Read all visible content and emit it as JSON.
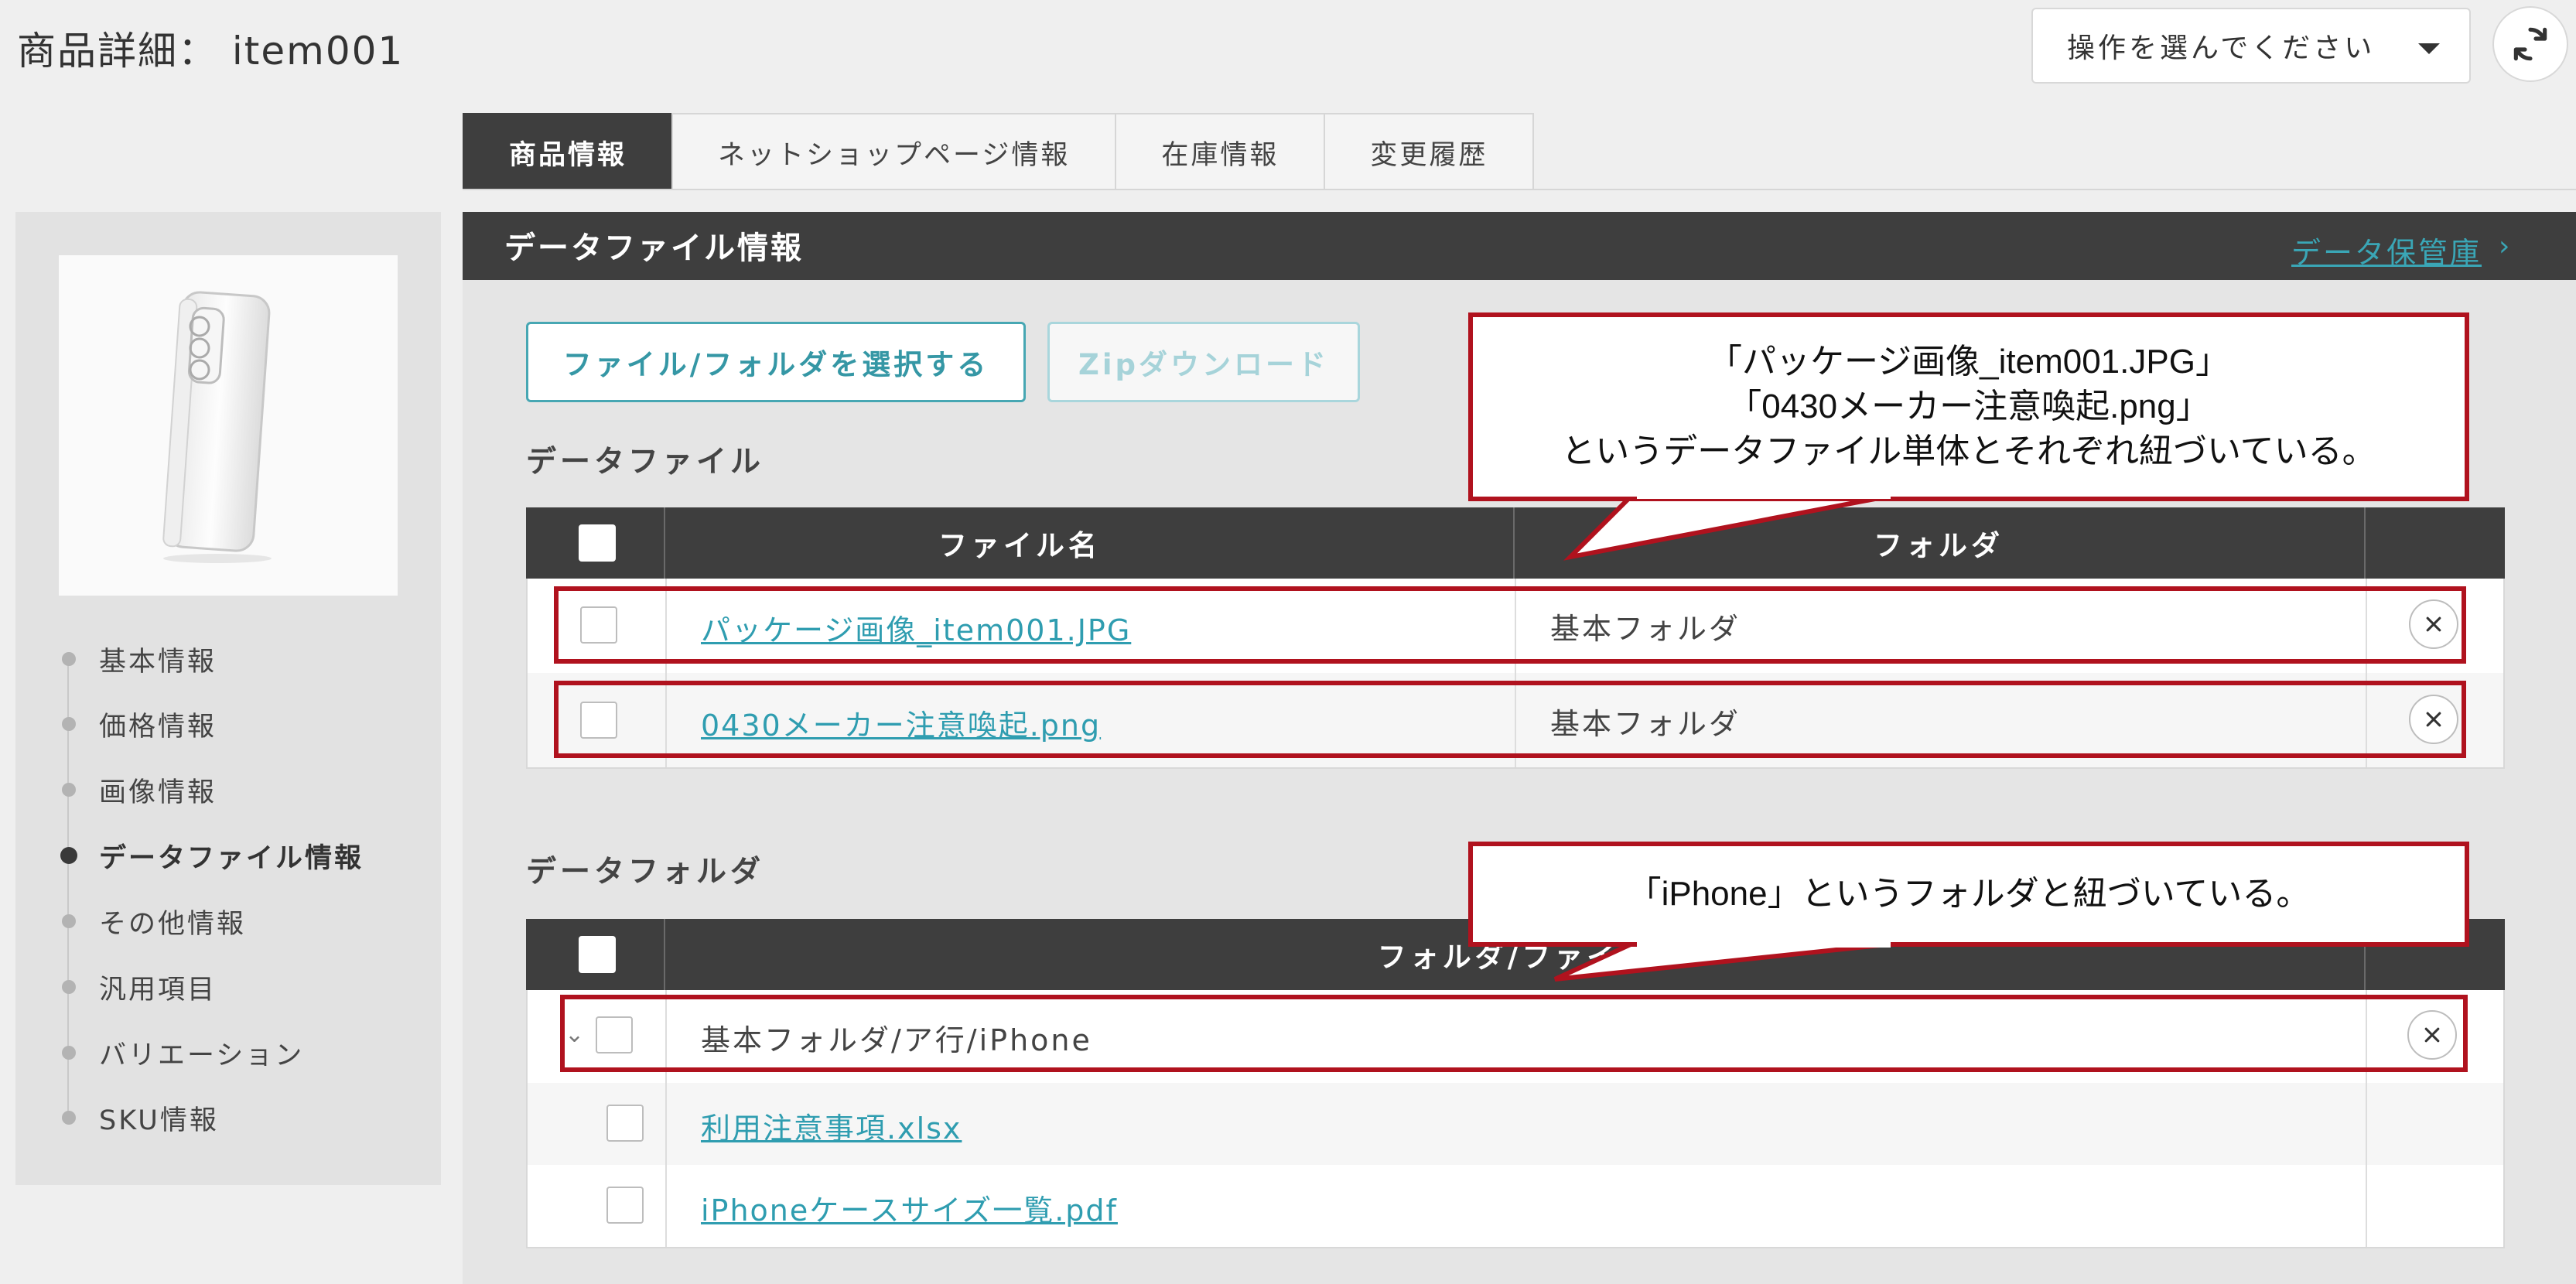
{
  "header": {
    "title": "商品詳細： item001",
    "action_select": "操作を選んでください",
    "refresh_icon": "refresh-icon"
  },
  "tabs": [
    {
      "label": "商品情報",
      "active": true
    },
    {
      "label": "ネットショップページ情報",
      "active": false
    },
    {
      "label": "在庫情報",
      "active": false
    },
    {
      "label": "変更履歴",
      "active": false
    }
  ],
  "sidebar": {
    "items": [
      {
        "label": "基本情報",
        "active": false
      },
      {
        "label": "価格情報",
        "active": false
      },
      {
        "label": "画像情報",
        "active": false
      },
      {
        "label": "データファイル情報",
        "active": true
      },
      {
        "label": "その他情報",
        "active": false
      },
      {
        "label": "汎用項目",
        "active": false
      },
      {
        "label": "バリエーション",
        "active": false
      },
      {
        "label": "SKU情報",
        "active": false
      }
    ]
  },
  "section": {
    "title": "データファイル情報",
    "vault_link": "データ保管庫",
    "select_button": "ファイル/フォルダを選択する",
    "zip_button": "Zipダウンロード"
  },
  "files": {
    "title": "データファイル",
    "col_name": "ファイル名",
    "col_folder": "フォルダ",
    "rows": [
      {
        "name": "パッケージ画像_item001.JPG",
        "folder": "基本フォルダ"
      },
      {
        "name": "0430メーカー注意喚起.png",
        "folder": "基本フォルダ"
      }
    ]
  },
  "folders": {
    "title": "データフォルダ",
    "col_name": "フォルダ/ファイル",
    "folder_row": "基本フォルダ/ア行/iPhone",
    "children": [
      {
        "name": "利用注意事項.xlsx"
      },
      {
        "name": "iPhoneケースサイズ一覧.pdf"
      }
    ]
  },
  "callouts": {
    "files": [
      "「パッケージ画像_item001.JPG」",
      "「0430メーカー注意喚起.png」",
      "というデータファイル単体とそれぞれ紐づいている。"
    ],
    "folders": [
      "「iPhone」というフォルダと紐づいている。"
    ]
  },
  "colors": {
    "header_dark": "#3e3e3e",
    "accent_teal": "#2f9db0",
    "annotation_red": "#b0121e"
  }
}
